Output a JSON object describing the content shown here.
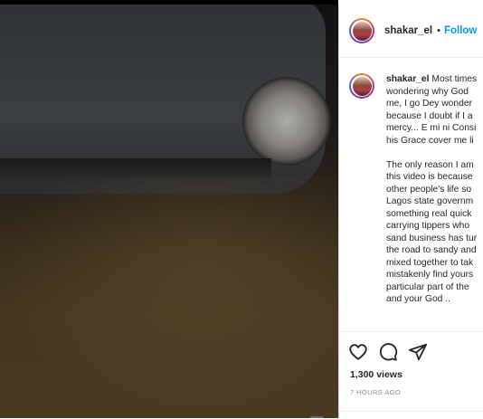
{
  "post": {
    "username": "shakar_el",
    "follow_label": "Follow",
    "separator": "•"
  },
  "caption": {
    "username": "shakar_el",
    "lines": [
      " Most times",
      "wondering why God",
      "me, I go Dey wonder",
      "because I doubt if I a",
      "mercy... E mi ni Consi",
      "his Grace cover me li",
      "",
      "The only reason I am",
      "this video is because",
      "other people's life so",
      "Lagos state governm",
      "something real quick",
      "carrying tippers who",
      "sand business has tur",
      "the road to sandy and",
      "mixed together to tak",
      "mistakenly find yours",
      "particular part of the",
      "and your God .."
    ]
  },
  "engagement": {
    "views": "1,300 views",
    "timestamp": "7 HOURS AGO"
  },
  "icons": {
    "like": "heart-icon",
    "comment": "comment-icon",
    "share": "share-icon"
  },
  "colors": {
    "accent": "#0095f6",
    "text": "#262626",
    "muted": "#8e8e8e"
  }
}
